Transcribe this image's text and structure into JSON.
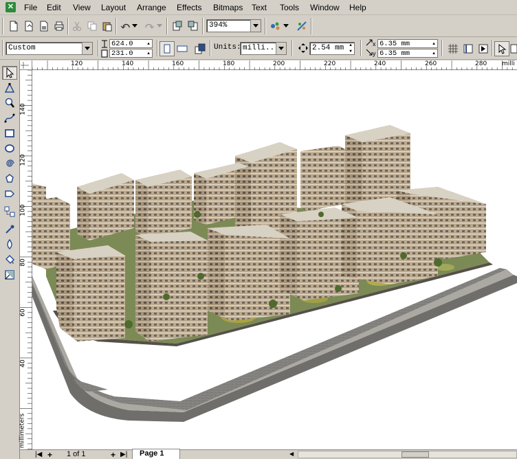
{
  "menu": {
    "items": [
      "File",
      "Edit",
      "View",
      "Layout",
      "Arrange",
      "Effects",
      "Bitmaps",
      "Text",
      "Tools",
      "Window",
      "Help"
    ]
  },
  "toolbar": {
    "zoom_value": "394%"
  },
  "property_bar": {
    "paper_type": "Custom",
    "page_width": "624.0",
    "page_height": "231.0",
    "units_label": "Units:",
    "units_value": "milli...",
    "nudge_value": "2.54 mm",
    "dup_x": "6.35 mm",
    "dup_y": "6.35 mm",
    "dup_x_label": "x",
    "dup_y_label": "y"
  },
  "rulers": {
    "h_labels": [
      "120",
      "140",
      "160",
      "180",
      "200",
      "220",
      "240",
      "260",
      "280"
    ],
    "h_unit": "milli",
    "v_labels": [
      "140",
      "120",
      "100",
      "80",
      "60",
      "40"
    ],
    "v_unit": "millimeters"
  },
  "statusbar": {
    "page_count": "1 of 1",
    "page_tab": "Page 1"
  },
  "colors": {
    "chrome": "#d4d0c8",
    "grass": "#7c8a56",
    "building": "#b5a38b"
  }
}
